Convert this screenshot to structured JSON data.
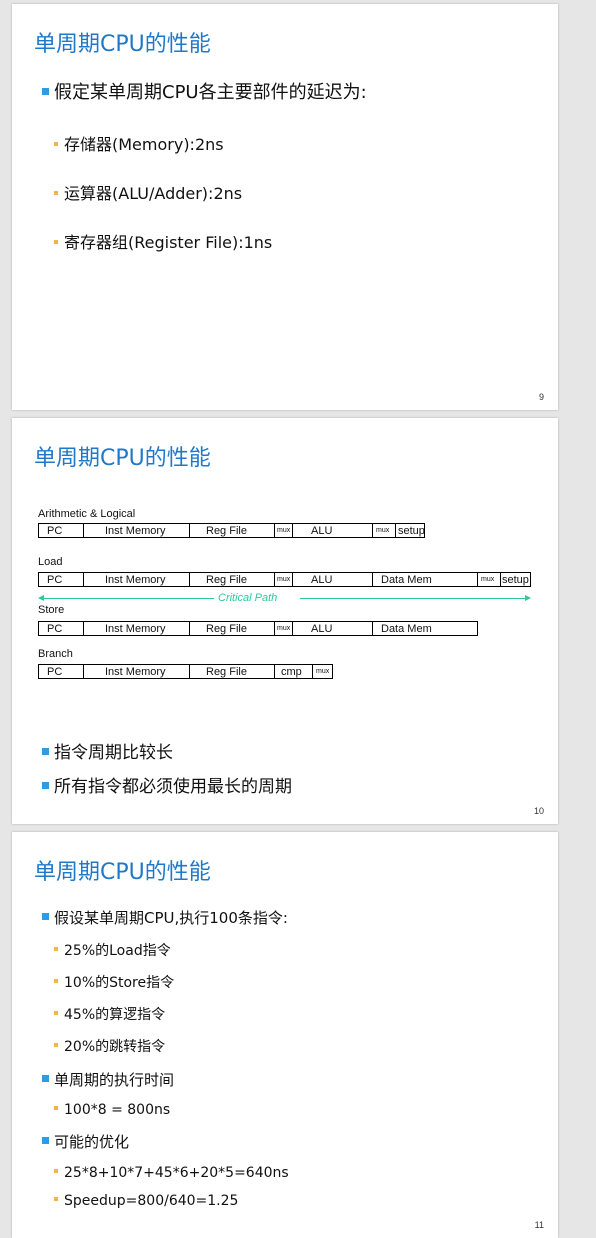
{
  "slides": [
    {
      "title": "单周期CPU的性能",
      "page": "9",
      "bullet": "假定某单周期CPU各主要部件的延迟为:",
      "sub": [
        "存储器(Memory):2ns",
        "运算器(ALU/Adder):2ns",
        "寄存器组(Register File):1ns"
      ]
    },
    {
      "title": "单周期CPU的性能",
      "page": "10",
      "diagram": {
        "rows": [
          {
            "label": "Arithmetic & Logical",
            "stages": [
              "PC",
              "Inst Memory",
              "Reg File",
              "mux",
              "ALU",
              "mux",
              "setup"
            ]
          },
          {
            "label": "Load",
            "stages": [
              "PC",
              "Inst Memory",
              "Reg File",
              "mux",
              "ALU",
              "Data Mem",
              "mux",
              "setup"
            ]
          },
          {
            "label": "Store",
            "stages": [
              "PC",
              "Inst Memory",
              "Reg File",
              "mux",
              "ALU",
              "Data Mem"
            ]
          },
          {
            "label": "Branch",
            "stages": [
              "PC",
              "Inst Memory",
              "Reg File",
              "cmp",
              "mux"
            ]
          }
        ],
        "critical_path": "Critical Path",
        "critical_color": "#2ec99a"
      },
      "bullets": [
        "指令周期比较长",
        "所有指令都必须使用最长的周期"
      ]
    },
    {
      "title": "单周期CPU的性能",
      "page": "11",
      "b1": "假设某单周期CPU,执行100条指令:",
      "b1_sub": [
        "25%的Load指令",
        "10%的Store指令",
        "45%的算逻指令",
        "20%的跳转指令"
      ],
      "b2": "单周期的执行时间",
      "b2_sub": "100*8 = 800ns",
      "b3": "可能的优化",
      "b3_sub": [
        "25*8+10*7+45*6+20*5=640ns",
        "Speedup=800/640=1.25"
      ]
    }
  ],
  "colors": {
    "title": "#1f78c8",
    "bullet_square": "#2f9be0",
    "sub_bullet": "#f3b24b"
  }
}
